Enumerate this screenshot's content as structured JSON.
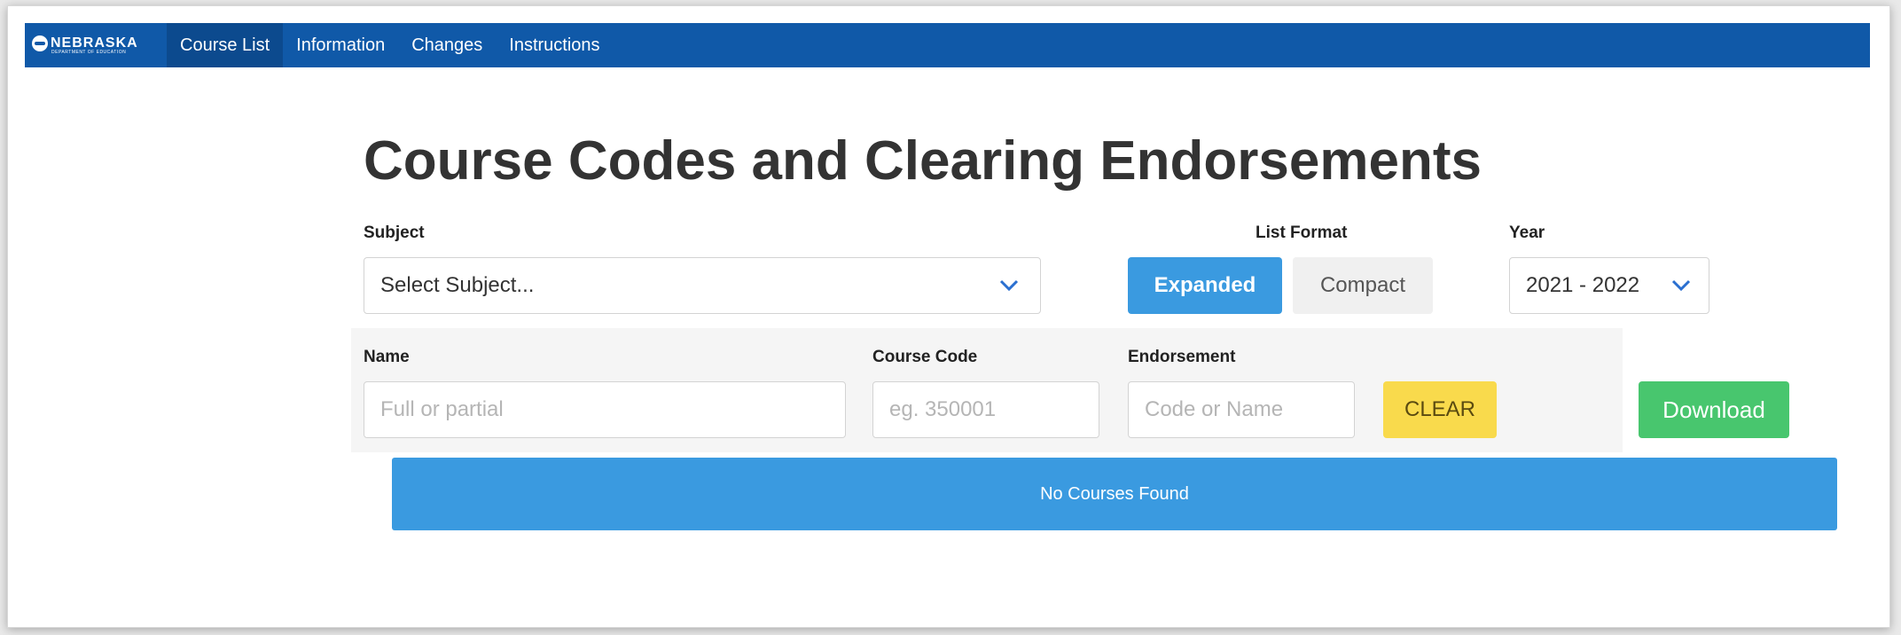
{
  "nav": {
    "brand_name": "NEBRASKA",
    "brand_sub": "DEPARTMENT OF EDUCATION",
    "items": [
      {
        "label": "Course List",
        "active": true
      },
      {
        "label": "Information",
        "active": false
      },
      {
        "label": "Changes",
        "active": false
      },
      {
        "label": "Instructions",
        "active": false
      }
    ]
  },
  "page_title": "Course Codes and Clearing Endorsements",
  "subject": {
    "label": "Subject",
    "value": "Select Subject..."
  },
  "list_format": {
    "label": "List Format",
    "expanded_label": "Expanded",
    "compact_label": "Compact",
    "selected": "Expanded"
  },
  "year": {
    "label": "Year",
    "value": "2021 - 2022"
  },
  "filters": {
    "name_label": "Name",
    "name_placeholder": "Full or partial",
    "code_label": "Course Code",
    "code_placeholder": "eg. 350001",
    "endorsement_label": "Endorsement",
    "endorsement_placeholder": "Code or Name",
    "clear_label": "CLEAR"
  },
  "download_label": "Download",
  "results_message": "No Courses Found",
  "colors": {
    "nav_bg": "#1059a8",
    "primary": "#3a9ae0",
    "clear": "#f9da4c",
    "download": "#48c66e"
  }
}
